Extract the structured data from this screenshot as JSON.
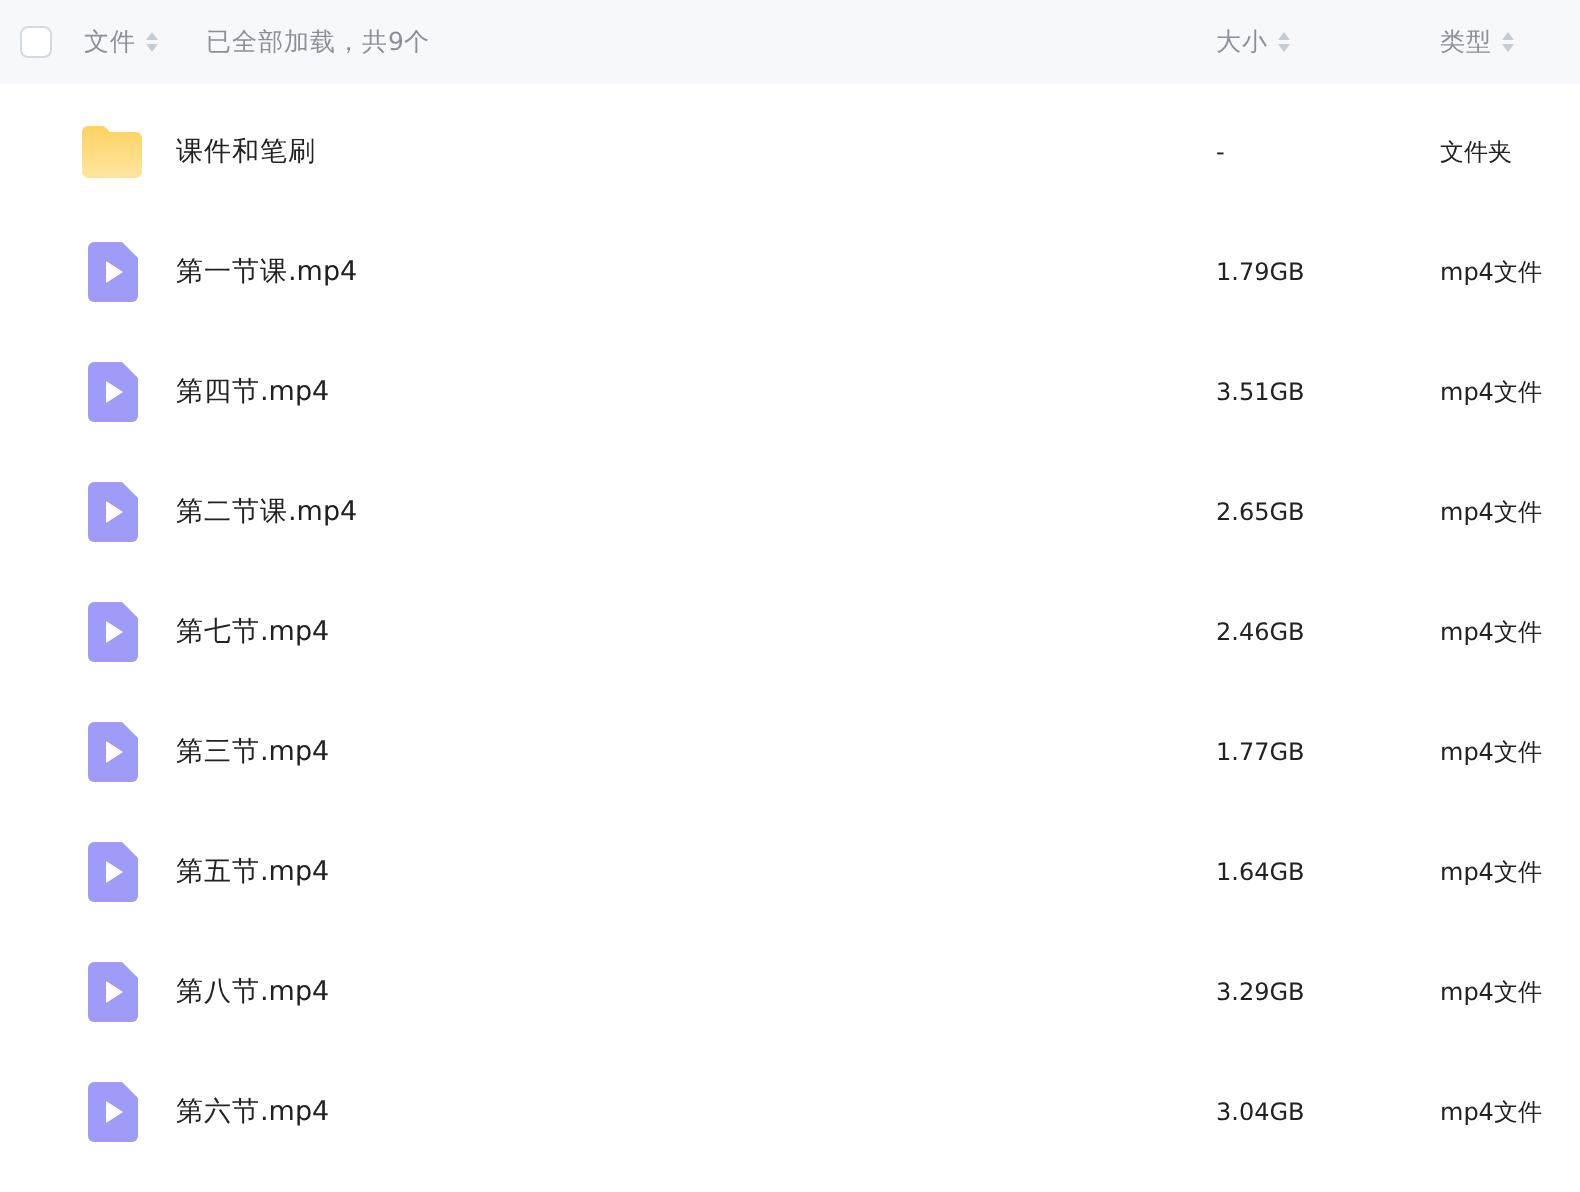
{
  "header": {
    "select_all": {
      "checked": false
    },
    "columns": [
      "文件",
      "大小",
      "类型"
    ],
    "status": "已全部加载，共9个"
  },
  "files": [
    {
      "kind": "folder",
      "name": "课件和笔刷",
      "size": "-",
      "type": "文件夹"
    },
    {
      "kind": "video",
      "name": "第一节课.mp4",
      "size": "1.79GB",
      "type": "mp4文件"
    },
    {
      "kind": "video",
      "name": "第四节.mp4",
      "size": "3.51GB",
      "type": "mp4文件"
    },
    {
      "kind": "video",
      "name": "第二节课.mp4",
      "size": "2.65GB",
      "type": "mp4文件"
    },
    {
      "kind": "video",
      "name": "第七节.mp4",
      "size": "2.46GB",
      "type": "mp4文件"
    },
    {
      "kind": "video",
      "name": "第三节.mp4",
      "size": "1.77GB",
      "type": "mp4文件"
    },
    {
      "kind": "video",
      "name": "第五节.mp4",
      "size": "1.64GB",
      "type": "mp4文件"
    },
    {
      "kind": "video",
      "name": "第八节.mp4",
      "size": "3.29GB",
      "type": "mp4文件"
    },
    {
      "kind": "video",
      "name": "第六节.mp4",
      "size": "3.04GB",
      "type": "mp4文件"
    }
  ]
}
